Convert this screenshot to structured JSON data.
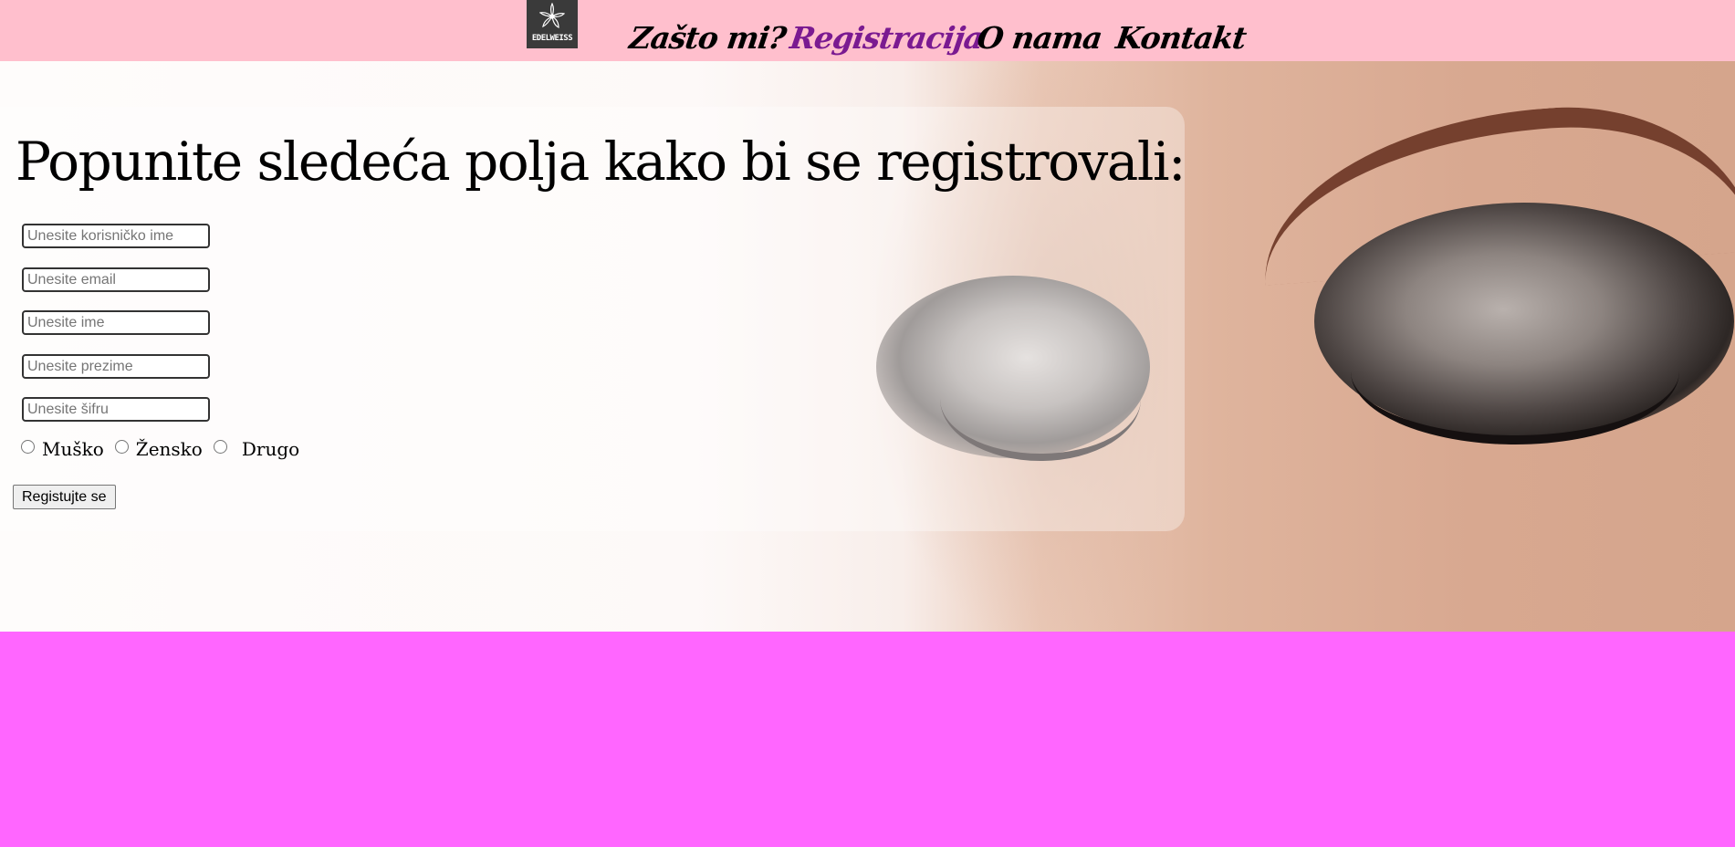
{
  "nav": {
    "logo_text": "EDELWEISS",
    "links": [
      {
        "label": "Zašto mi?",
        "active": false
      },
      {
        "label": "Registracija",
        "active": true
      },
      {
        "label": "O nama",
        "active": false
      },
      {
        "label": "Kontakt",
        "active": false
      }
    ],
    "active_color": "#7a1a91",
    "background": "#ffbfcd"
  },
  "form": {
    "title": "Popunite sledeća polja kako bi se registrovali:",
    "fields": [
      {
        "placeholder": "Unesite korisničko ime",
        "value": ""
      },
      {
        "placeholder": "Unesite email",
        "value": ""
      },
      {
        "placeholder": "Unesite ime",
        "value": ""
      },
      {
        "placeholder": "Unesite prezime",
        "value": ""
      },
      {
        "placeholder": "Unesite šifru",
        "value": ""
      }
    ],
    "gender_options": [
      "Muško",
      "Žensko",
      "Drugo"
    ],
    "submit_label": "Registujte se"
  },
  "footer": {
    "background": "#ff66ff"
  },
  "icons": {
    "logo": "edelweiss-flower-icon"
  }
}
